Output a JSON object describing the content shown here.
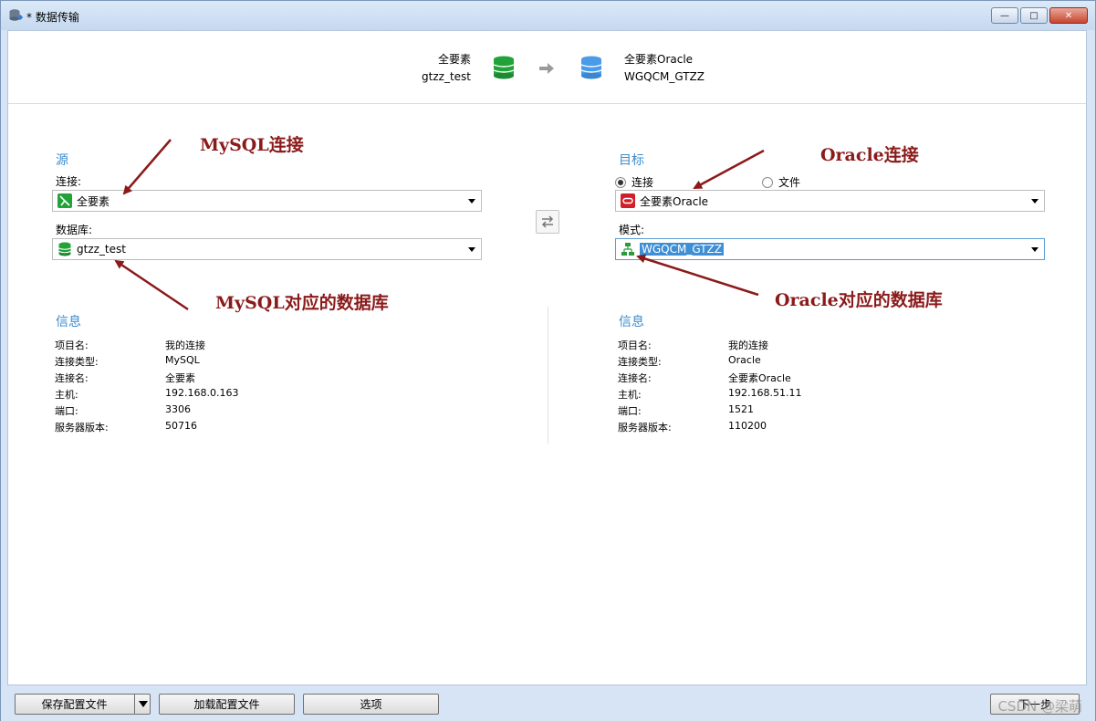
{
  "window": {
    "title": "* 数据传输",
    "buttons": {
      "minimize": "—",
      "maximize": "□",
      "close": "✕"
    }
  },
  "header": {
    "source_name": "全要素",
    "source_db": "gtzz_test",
    "target_name": "全要素Oracle",
    "target_db": "WGQCM_GTZZ"
  },
  "source": {
    "title": "源",
    "connection_label": "连接:",
    "connection_value": "全要素",
    "database_label": "数据库:",
    "database_value": "gtzz_test"
  },
  "target": {
    "title": "目标",
    "radio_connection": "连接",
    "radio_file": "文件",
    "connection_value": "全要素Oracle",
    "schema_label": "模式:",
    "schema_value": "WGQCM_GTZZ"
  },
  "source_info": {
    "title": "信息",
    "rows": [
      {
        "key": "项目名:",
        "value": "我的连接"
      },
      {
        "key": "连接类型:",
        "value": "MySQL"
      },
      {
        "key": "连接名:",
        "value": "全要素"
      },
      {
        "key": "主机:",
        "value": "192.168.0.163"
      },
      {
        "key": "端口:",
        "value": "3306"
      },
      {
        "key": "服务器版本:",
        "value": "50716"
      }
    ]
  },
  "target_info": {
    "title": "信息",
    "rows": [
      {
        "key": "项目名:",
        "value": "我的连接"
      },
      {
        "key": "连接类型:",
        "value": "Oracle"
      },
      {
        "key": "连接名:",
        "value": "全要素Oracle"
      },
      {
        "key": "主机:",
        "value": "192.168.51.11"
      },
      {
        "key": "端口:",
        "value": "1521"
      },
      {
        "key": "服务器版本:",
        "value": "110200"
      }
    ]
  },
  "annotations": {
    "mysql_conn": "MySQL连接",
    "mysql_db": "MySQL对应的数据库",
    "oracle_conn": "Oracle连接",
    "oracle_db": "Oracle对应的数据库"
  },
  "footer": {
    "save_config": "保存配置文件",
    "load_config": "加载配置文件",
    "options": "选项",
    "next": "下一步",
    "watermark": "CSDN @梁萌"
  },
  "colors": {
    "accent": "#3d8ccc",
    "annotation": "#8b1a1a",
    "mysql_green": "#22a33a",
    "oracle_red": "#d11f2a",
    "db_blue": "#4a9be8"
  }
}
